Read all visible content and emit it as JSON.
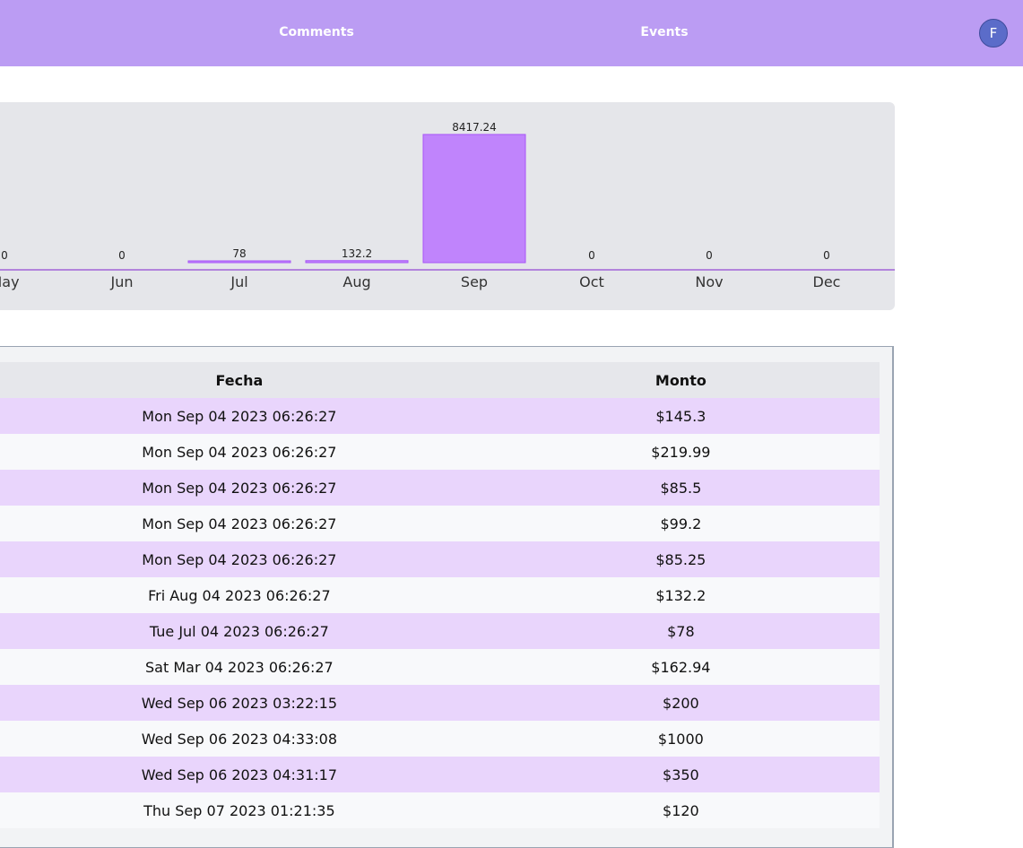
{
  "header": {
    "nav": [
      {
        "label": "Comments"
      },
      {
        "label": "Events"
      }
    ],
    "avatar_initial": "F"
  },
  "chart_data": {
    "type": "bar",
    "categories": [
      "May",
      "Jun",
      "Jul",
      "Aug",
      "Sep",
      "Oct",
      "Nov",
      "Dec"
    ],
    "values": [
      0,
      0,
      78,
      132.2,
      8417.24,
      0,
      0,
      0
    ],
    "value_labels": [
      "0",
      "0",
      "78",
      "132.2",
      "8417.24",
      "0",
      "0",
      "0"
    ],
    "title": "",
    "xlabel": "",
    "ylabel": "",
    "bar_color": "#c084fc",
    "bar_border_color": "#a855f7",
    "axis_color": "#7e22ce",
    "grid": false
  },
  "table": {
    "columns": [
      "Fecha",
      "Monto"
    ],
    "rows": [
      [
        "Mon Sep 04 2023 06:26:27",
        "$145.3"
      ],
      [
        "Mon Sep 04 2023 06:26:27",
        "$219.99"
      ],
      [
        "Mon Sep 04 2023 06:26:27",
        "$85.5"
      ],
      [
        "Mon Sep 04 2023 06:26:27",
        "$99.2"
      ],
      [
        "Mon Sep 04 2023 06:26:27",
        "$85.25"
      ],
      [
        "Fri Aug 04 2023 06:26:27",
        "$132.2"
      ],
      [
        "Tue Jul 04 2023 06:26:27",
        "$78"
      ],
      [
        "Sat Mar 04 2023 06:26:27",
        "$162.94"
      ],
      [
        "Wed Sep 06 2023 03:22:15",
        "$200"
      ],
      [
        "Wed Sep 06 2023 04:33:08",
        "$1000"
      ],
      [
        "Wed Sep 06 2023 04:31:17",
        "$350"
      ],
      [
        "Thu Sep 07 2023 01:21:35",
        "$120"
      ]
    ],
    "row_colors": {
      "odd": "#e9d5fc",
      "even": "#f8f9fb"
    }
  }
}
